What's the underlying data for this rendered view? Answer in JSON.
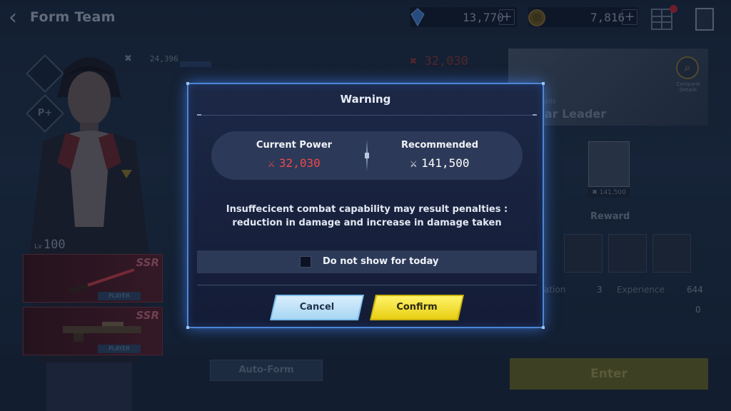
{
  "header": {
    "title": "Form Team",
    "gems": "13,770",
    "gold": "7,816",
    "plus": "+",
    "coin_glyph": "◎"
  },
  "character": {
    "power_small": "24,396",
    "level_prefix": "Lv",
    "level": "100",
    "side_btn_p": "P+",
    "weapon_1": {
      "rarity": "SSR",
      "tag": "PLAYER"
    },
    "weapon_2": {
      "rarity": "SSR",
      "tag": "PLAYER"
    }
  },
  "stage": {
    "team_power": "32,030",
    "boss_title": "ear Leader",
    "boss_sub": "etails",
    "conquest_label": "Conquest Details",
    "monster_power": "141,500",
    "reward_label": "Reward",
    "info_left_label": "ation",
    "info_left_value": "3",
    "info_right_label": "Experience",
    "info_right_value": "644",
    "info_extra_value": "0",
    "enter_label": "Enter",
    "autoform_label": "Auto-Form"
  },
  "modal": {
    "title": "Warning",
    "current_power_label": "Current Power",
    "current_power_value": "32,030",
    "recommended_label": "Recommended",
    "recommended_value": "141,500",
    "message_line1": "Insuffecicent combat capability may result penalties :",
    "message_line2": "reduction in damage and increase in damage taken",
    "checkbox_label": "Do not show for today",
    "checkbox_checked": false,
    "cancel_label": "Cancel",
    "confirm_label": "Confirm"
  },
  "colors": {
    "modal_border": "#4c86d6",
    "current_power": "#f0484a",
    "confirm_button": "#e8cf12",
    "cancel_button": "#a9d6f3"
  }
}
